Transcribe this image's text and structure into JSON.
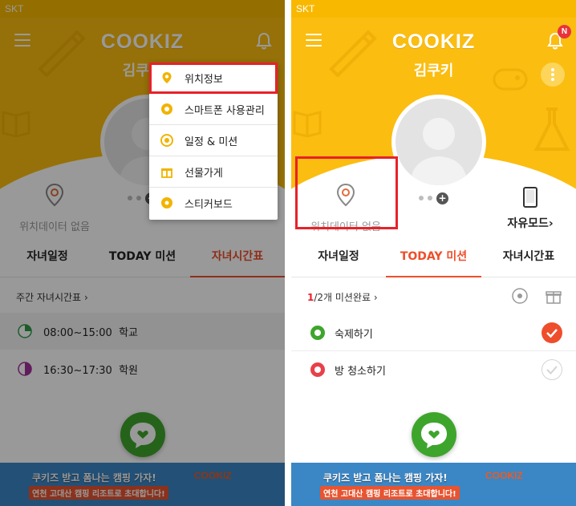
{
  "colors": {
    "brand_yellow": "#fbbd10",
    "accent_red": "#ee4e2b",
    "fab_green": "#3ea52c",
    "highlight_red": "#e8212a"
  },
  "status_bar": {
    "carrier": "SKT"
  },
  "app": {
    "logo": "COOKIZ",
    "notification_badge": "N"
  },
  "child": {
    "name": "김쿠키"
  },
  "location": {
    "text": "위치데이터 없음"
  },
  "free_mode": {
    "label": "자유모드",
    "chevron": "›"
  },
  "tabs": [
    "자녀일정",
    "TODAY 미션",
    "자녀시간표"
  ],
  "left_screen": {
    "active_tab": "자녀시간표",
    "weekly_schedule_link": "주간 자녀시간표",
    "schedule": [
      {
        "time": "08:00~15:00",
        "place": "학교",
        "color": "#2e9a48",
        "progress": 0.25
      },
      {
        "time": "16:30~17:30",
        "place": "학원",
        "color": "#a22f9b",
        "progress": 0.5
      }
    ],
    "dropdown_menu": [
      {
        "label": "위치정보",
        "icon": "location-pin-icon",
        "highlighted": true
      },
      {
        "label": "스마트폰 사용관리",
        "icon": "settings-gear-icon"
      },
      {
        "label": "일정 & 미션",
        "icon": "target-icon"
      },
      {
        "label": "선물가게",
        "icon": "gift-icon"
      },
      {
        "label": "스티커보드",
        "icon": "sticker-icon"
      }
    ]
  },
  "right_screen": {
    "active_tab": "TODAY 미션",
    "mission_progress": {
      "done": "1",
      "rest": "/2개 미션완료",
      "chevron": "›"
    },
    "missions": [
      {
        "label": "숙제하기",
        "completed": true,
        "icon_color": "#3ea52c"
      },
      {
        "label": "방 청소하기",
        "completed": false,
        "icon_color": "#e8404a"
      }
    ]
  },
  "banner": {
    "headline": "쿠키즈 받고 폼나는 캠핑 가자!",
    "sub": "연천 고대산 캠핑 리조트로 초대합니다!",
    "brand": "COOKIZ"
  }
}
